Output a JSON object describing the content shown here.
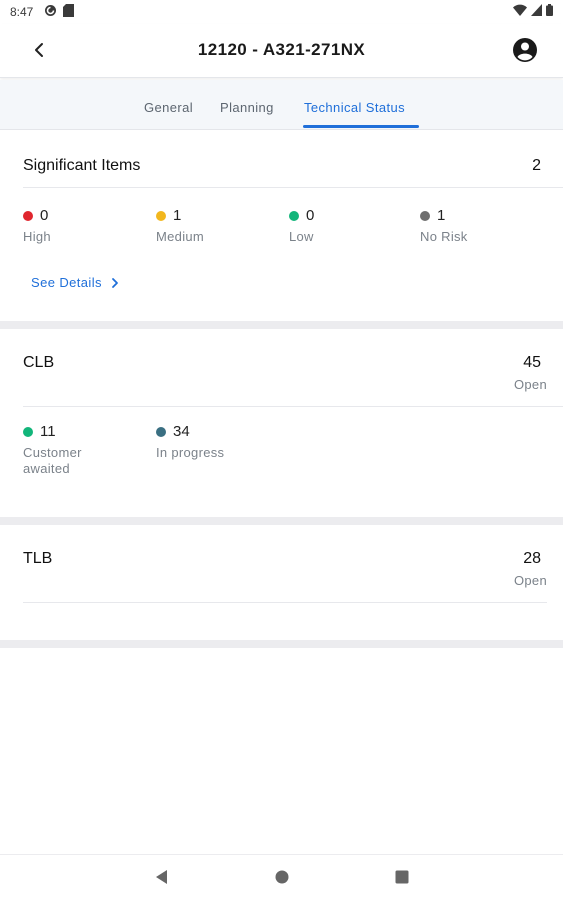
{
  "status_bar": {
    "time": "8:47"
  },
  "header": {
    "title": "12120 - A321-271NX",
    "back_icon": "chevron-left-icon",
    "account_icon": "account-circle-icon"
  },
  "tabs": [
    {
      "label": "General",
      "active": false
    },
    {
      "label": "Planning",
      "active": false
    },
    {
      "label": "Technical Status",
      "active": true
    }
  ],
  "significant_items": {
    "title": "Significant Items",
    "count": "2",
    "stats": [
      {
        "value": "0",
        "label": "High",
        "color": "#e0262e"
      },
      {
        "value": "1",
        "label": "Medium",
        "color": "#f2b71e"
      },
      {
        "value": "0",
        "label": "Low",
        "color": "#12b57a"
      },
      {
        "value": "1",
        "label": "No Risk",
        "color": "#6e6e6e"
      }
    ],
    "link": "See Details"
  },
  "clb": {
    "title": "CLB",
    "count": "45",
    "count_label": "Open",
    "stats": [
      {
        "value": "11",
        "label_line1": "Customer",
        "label_line2": "awaited",
        "color": "#12b57a"
      },
      {
        "value": "34",
        "label_line1": "In progress",
        "label_line2": "",
        "color": "#3a6f82"
      }
    ]
  },
  "tlb": {
    "title": "TLB",
    "count": "28",
    "count_label": "Open"
  },
  "colors": {
    "accent": "#1f6fd9"
  }
}
